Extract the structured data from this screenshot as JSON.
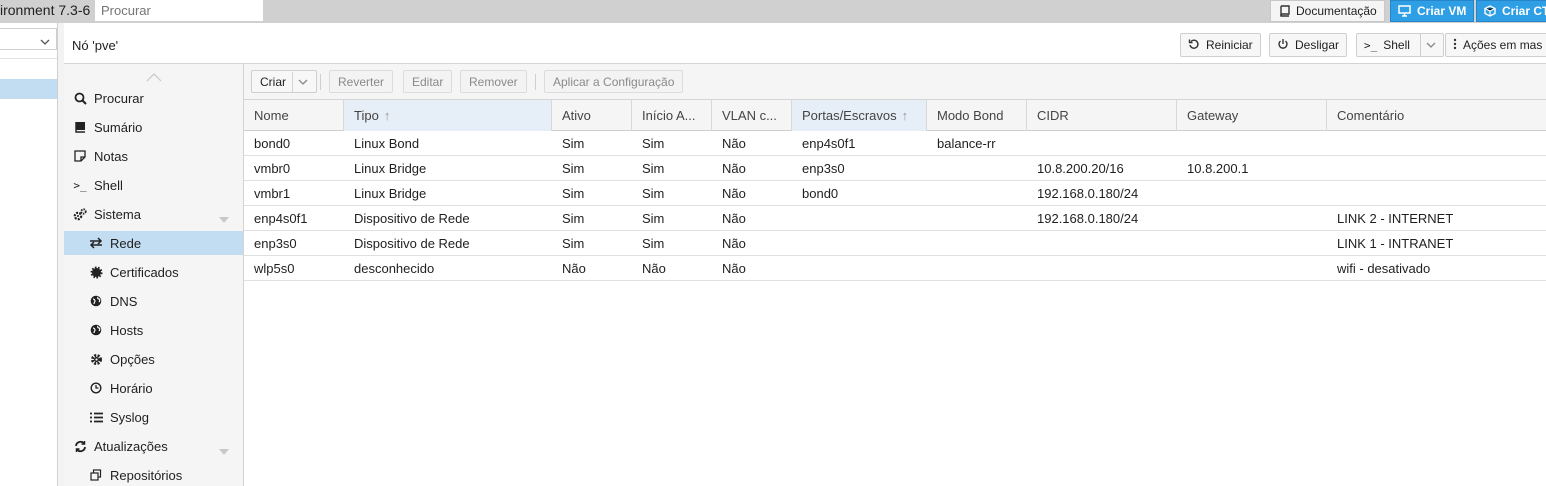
{
  "topbar": {
    "app_title": "ironment 7.3-6",
    "search_placeholder": "Procurar",
    "docs_label": "Documentação",
    "create_vm_label": "Criar VM",
    "create_ct_label": "Criar CT"
  },
  "node": {
    "title": "Nó 'pve'",
    "reboot_label": "Reiniciar",
    "shutdown_label": "Desligar",
    "shell_label": "Shell",
    "more_label": "Ações em mas"
  },
  "menu": {
    "items": [
      {
        "label": "Procurar",
        "icon": "search-icon"
      },
      {
        "label": "Sumário",
        "icon": "book-icon"
      },
      {
        "label": "Notas",
        "icon": "note-icon"
      },
      {
        "label": "Shell",
        "icon": "terminal-icon"
      },
      {
        "label": "Sistema",
        "icon": "cogs-icon"
      },
      {
        "label": "Rede",
        "icon": "exchange-icon"
      },
      {
        "label": "Certificados",
        "icon": "certificate-icon"
      },
      {
        "label": "DNS",
        "icon": "globe-icon"
      },
      {
        "label": "Hosts",
        "icon": "globe-icon"
      },
      {
        "label": "Opções",
        "icon": "gear-icon"
      },
      {
        "label": "Horário",
        "icon": "clock-icon"
      },
      {
        "label": "Syslog",
        "icon": "list-icon"
      },
      {
        "label": "Atualizações",
        "icon": "refresh-icon"
      },
      {
        "label": "Repositórios",
        "icon": "copy-icon"
      }
    ]
  },
  "toolbar": {
    "create_label": "Criar",
    "revert_label": "Reverter",
    "edit_label": "Editar",
    "remove_label": "Remover",
    "apply_label": "Aplicar a Configuração"
  },
  "grid": {
    "headers": [
      "Nome",
      "Tipo",
      "Ativo",
      "Início A...",
      "VLAN c...",
      "Portas/Escravos",
      "Modo Bond",
      "CIDR",
      "Gateway",
      "Comentário"
    ],
    "rows": [
      [
        "bond0",
        "Linux Bond",
        "Sim",
        "Sim",
        "Não",
        "enp4s0f1",
        "balance-rr",
        "",
        "",
        ""
      ],
      [
        "vmbr0",
        "Linux Bridge",
        "Sim",
        "Sim",
        "Não",
        "enp3s0",
        "",
        "10.8.200.20/16",
        "10.8.200.1",
        ""
      ],
      [
        "vmbr1",
        "Linux Bridge",
        "Sim",
        "Sim",
        "Não",
        "bond0",
        "",
        "192.168.0.180/24",
        "",
        ""
      ],
      [
        "enp4s0f1",
        "Dispositivo de Rede",
        "Sim",
        "Sim",
        "Não",
        "",
        "",
        "192.168.0.180/24",
        "",
        "LINK 2 - INTERNET"
      ],
      [
        "enp3s0",
        "Dispositivo de Rede",
        "Sim",
        "Sim",
        "Não",
        "",
        "",
        "",
        "",
        "LINK 1 - INTRANET"
      ],
      [
        "wlp5s0",
        "desconhecido",
        "Não",
        "Não",
        "Não",
        "",
        "",
        "",
        "",
        "wifi - desativado"
      ]
    ]
  },
  "colors": {
    "accent": "#2e9fe5",
    "selection": "#c2ddf2"
  }
}
